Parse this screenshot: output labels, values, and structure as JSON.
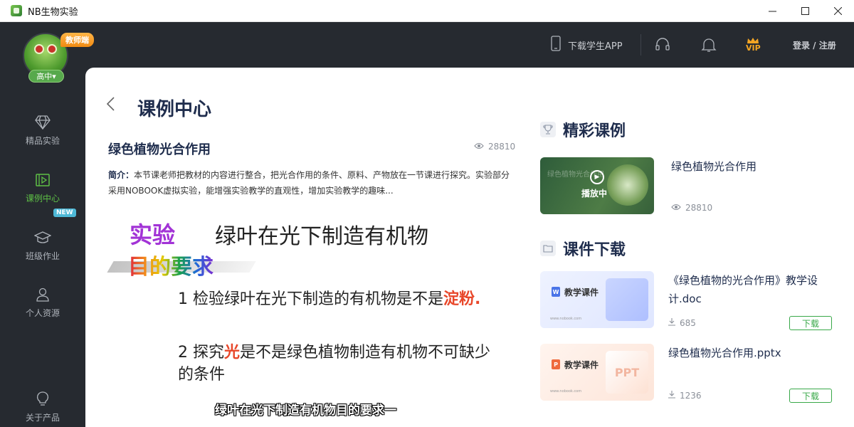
{
  "window": {
    "title": "NB生物实验"
  },
  "sidebar": {
    "grade": "高中▾",
    "role_tag": "教师端",
    "items": [
      {
        "label": "精品实验",
        "icon": "diamond-icon"
      },
      {
        "label": "课例中心",
        "icon": "play-square-icon",
        "active": true
      },
      {
        "label": "班级作业",
        "icon": "graduation-cap-icon",
        "badge": "NEW"
      },
      {
        "label": "个人资源",
        "icon": "person-icon"
      },
      {
        "label": "关于产品",
        "icon": "lightbulb-icon"
      }
    ]
  },
  "header": {
    "download_app": "下载学生APP",
    "vip": "VIP",
    "login": "登录 / 注册"
  },
  "main": {
    "page_title": "课例中心",
    "lesson_title": "绿色植物光合作用",
    "views": "28810",
    "description_label": "简介：",
    "description": "本节课老师把教材的内容进行整合，把光合作用的条件、原料、产物放在一节课进行探究。实验部分采用NOBOOK虚拟实验，能增强实验教学的直观性，增加实验教学的趣味...",
    "slide": {
      "heading": "实验",
      "heading_rest": "绿叶在光下制造有机物",
      "subheading": "目的要求",
      "point1_a": "1 检验绿叶在光下制造的有机物是不是",
      "point1_b": "淀粉.",
      "point2_a": "2 探究",
      "point2_b": "光",
      "point2_c": "是不是绿色植物制造有机物不可缺少的条件",
      "caption": "绿叶在光下制造有机物目的要求一"
    }
  },
  "featured": {
    "title": "精彩课例",
    "video": {
      "play_label": "播放中",
      "name": "绿色植物光合作用",
      "views": "28810",
      "thumb_text": "绿色植物光合作用"
    }
  },
  "downloads": {
    "title": "课件下载",
    "card_label": "教学课件",
    "site": "www.nobook.com",
    "button": "下载",
    "files": [
      {
        "name": "《绿色植物的光合作用》教学设计.doc",
        "count": "685",
        "type": "W",
        "color": "#4a74e8"
      },
      {
        "name": "绿色植物光合作用.pptx",
        "count": "1236",
        "type": "P",
        "color": "#ef6a3d",
        "deco": "PPT"
      }
    ]
  }
}
